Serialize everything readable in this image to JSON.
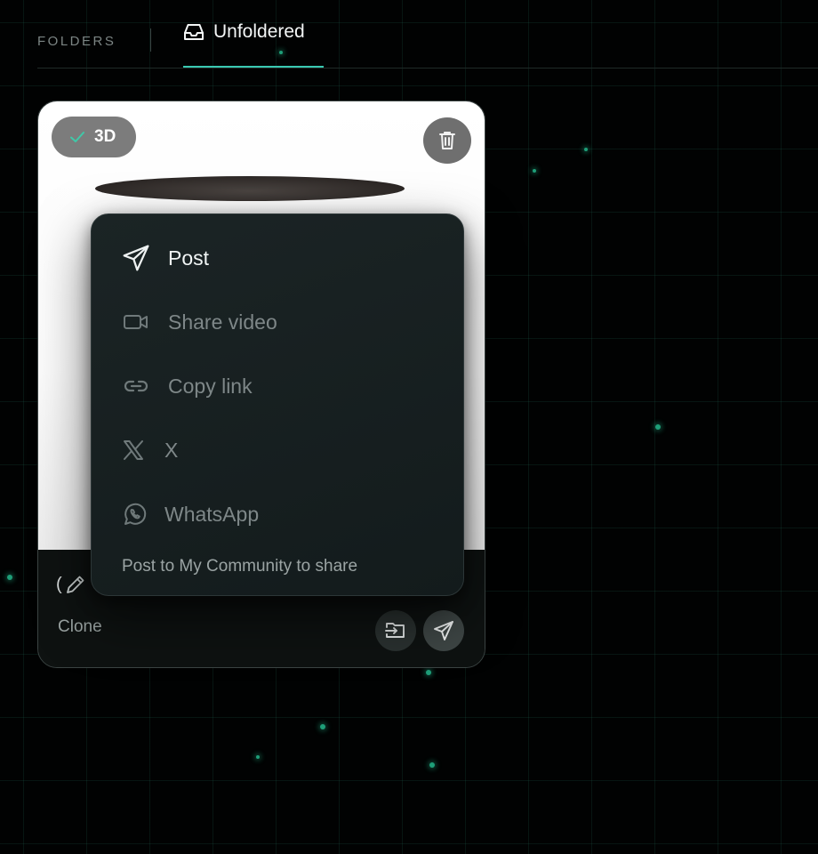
{
  "topbar": {
    "folders_label": "FOLDERS",
    "active_tab_label": "Unfoldered"
  },
  "card": {
    "badge_label": "3D",
    "title_fragment": "(",
    "clone_label": "Clone"
  },
  "share_menu": {
    "items": [
      {
        "label": "Post",
        "icon": "send-icon",
        "state": "active"
      },
      {
        "label": "Share video",
        "icon": "video-camera-icon",
        "state": "disabled"
      },
      {
        "label": "Copy link",
        "icon": "link-icon",
        "state": "disabled"
      },
      {
        "label": "X",
        "icon": "x-logo-icon",
        "state": "disabled"
      },
      {
        "label": "WhatsApp",
        "icon": "whatsapp-icon",
        "state": "disabled"
      }
    ],
    "footer_text": "Post to My Community to share"
  },
  "colors": {
    "accent": "#39c8b0",
    "background": "#010202",
    "menu_background": "#172021",
    "grid_dot": "#1e9e78"
  }
}
